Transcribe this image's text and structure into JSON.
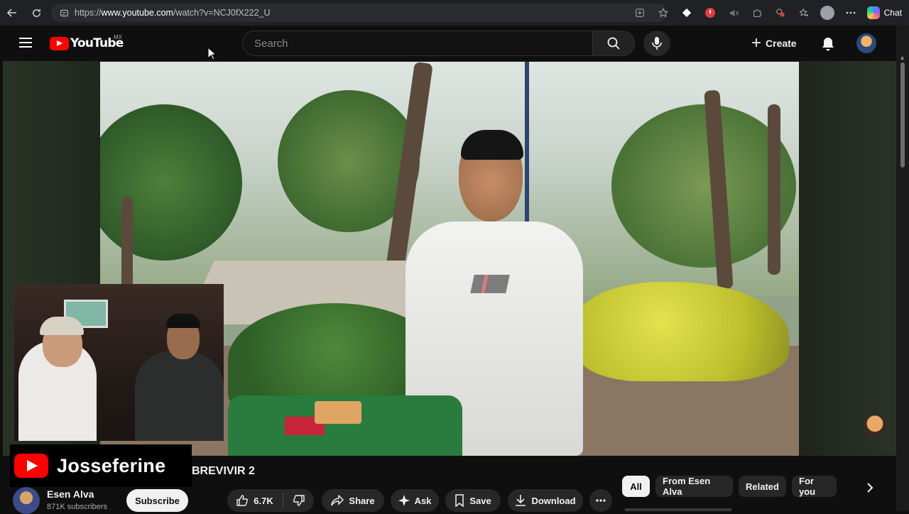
{
  "browser": {
    "url_prefix": "https://",
    "url_host": "www.youtube.com",
    "url_path": "/watch?v=NCJ0fX222_U",
    "chat_label": "Chat"
  },
  "header": {
    "logo_text": "YouTube",
    "country_code": "MX",
    "search_placeholder": "Search",
    "create_label": "Create"
  },
  "overlay": {
    "channel_watermark": "Josseferine"
  },
  "video": {
    "title_visible": "BREVIVIR 2",
    "channel_name": "Esen Alva",
    "subscribers": "871K subscribers",
    "subscribe_label": "Subscribe",
    "likes": "6.7K",
    "share_label": "Share",
    "ask_label": "Ask",
    "save_label": "Save",
    "download_label": "Download"
  },
  "chips": [
    {
      "label": "All",
      "active": true
    },
    {
      "label": "From Esen Alva",
      "active": false
    },
    {
      "label": "Related",
      "active": false
    },
    {
      "label": "For you",
      "active": false
    }
  ],
  "colors": {
    "brand_red": "#ff0000",
    "background": "#0f0f0f",
    "pill": "#272727"
  }
}
